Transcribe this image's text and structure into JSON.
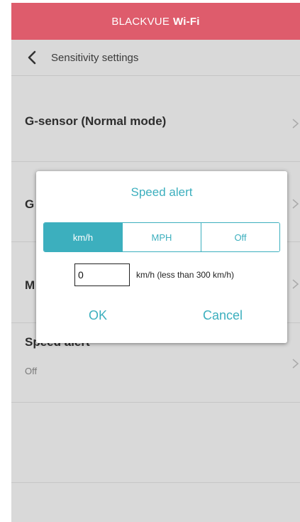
{
  "topbar": {
    "brand": "BLACKVUE",
    "brand_bold": "Wi-Fi",
    "color": "#de5c6c"
  },
  "nav": {
    "back_icon": "chevron-left-icon",
    "title": "Sensitivity settings"
  },
  "rows": [
    {
      "label": "G-sensor (Normal mode)"
    },
    {
      "label": "G"
    },
    {
      "label": "M"
    },
    {
      "label": "Speed alert",
      "value": "Off"
    }
  ],
  "dialog": {
    "title": "Speed alert",
    "units": [
      "km/h",
      "MPH",
      "Off"
    ],
    "selected_unit": "km/h",
    "input_value": "0",
    "unit_note": "km/h (less than 300 km/h)",
    "ok_label": "OK",
    "cancel_label": "Cancel",
    "accent": "#3cafbe"
  },
  "icons": {
    "chevron": "chevron-right-icon"
  }
}
